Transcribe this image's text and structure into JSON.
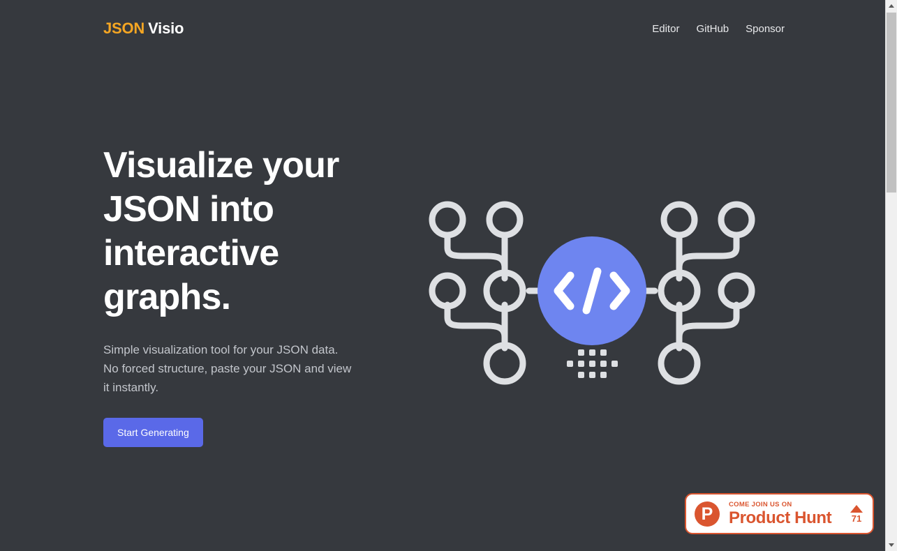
{
  "header": {
    "brand": {
      "primary": "JSON",
      "secondary": "Visio",
      "primary_color": "#f5a623",
      "secondary_color": "#ffffff"
    },
    "nav": [
      {
        "label": "Editor",
        "name": "nav-link-editor"
      },
      {
        "label": "GitHub",
        "name": "nav-link-github"
      },
      {
        "label": "Sponsor",
        "name": "nav-link-sponsor"
      }
    ]
  },
  "hero": {
    "title": "Visualize your JSON into interactive graphs.",
    "subtitle": "Simple visualization tool for your JSON data. No forced structure, paste your JSON and view it instantly.",
    "cta_label": "Start Generating",
    "cta_color": "#5a69e8",
    "graphic": {
      "center_icon": "code-brackets-icon",
      "center_icon_glyph": "</>",
      "center_circle_color": "#6e85f0",
      "node_stroke_color": "#dee0e3",
      "node_count": 10,
      "dot_grid_rows": [
        3,
        5,
        3
      ]
    }
  },
  "product_hunt": {
    "logo_letter": "P",
    "kicker": "COME JOIN US ON",
    "name": "Product Hunt",
    "vote_count": "71",
    "brand_color": "#da552f"
  },
  "scrollbar": {
    "up_arrow": "scroll-up-arrow",
    "down_arrow": "scroll-down-arrow",
    "thumb": "scroll-thumb"
  },
  "theme": {
    "background": "#36393e",
    "text_primary": "#ffffff",
    "text_muted": "#c3c6cc"
  }
}
